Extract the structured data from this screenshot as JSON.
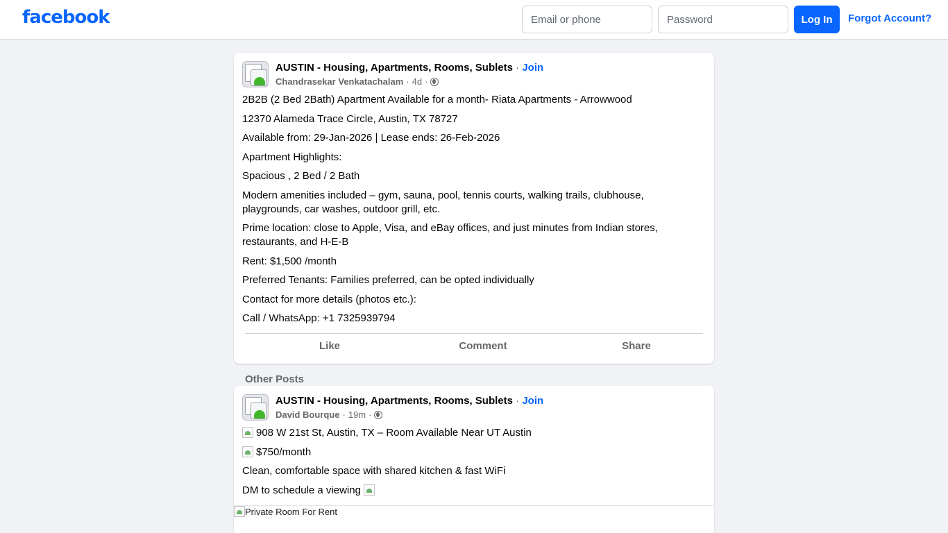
{
  "header": {
    "logo": "facebook",
    "email_placeholder": "Email or phone",
    "password_placeholder": "Password",
    "login_label": "Log In",
    "forgot_label": "Forgot Account?"
  },
  "post1": {
    "group": "AUSTIN - Housing, Apartments, Rooms, Sublets",
    "join": "Join",
    "author": "Chandrasekar Venkatachalam",
    "time": "4d",
    "lines": [
      "2B2B (2 Bed 2Bath) Apartment Available for a month- Riata Apartments - Arrowwood",
      "12370 Alameda Trace Circle, Austin, TX 78727",
      "Available from: 29-Jan-2026 | Lease ends: 26-Feb-2026",
      "Apartment Highlights:",
      "Spacious , 2 Bed / 2 Bath",
      "Modern amenities included – gym, sauna, pool, tennis courts, walking trails, clubhouse, playgrounds, car washes, outdoor grill, etc.",
      "Prime location: close to Apple, Visa, and eBay offices, and just minutes from Indian stores, restaurants, and H-E-B",
      "Rent: $1,500 /month",
      "Preferred Tenants: Families preferred, can be opted individually",
      "Contact for more details (photos etc.):",
      "Call / WhatsApp: +1 7325939794"
    ],
    "actions": {
      "like": "Like",
      "comment": "Comment",
      "share": "Share"
    }
  },
  "other_posts_label": "Other Posts",
  "post2": {
    "group": "AUSTIN - Housing, Apartments, Rooms, Sublets",
    "join": "Join",
    "author": "David Bourque",
    "time": "19m",
    "lines": [
      "908 W 21st St, Austin, TX – Room Available Near UT Austin",
      "$750/month",
      "Clean, comfortable space with shared kitchen & fast WiFi",
      "DM to schedule a viewing"
    ],
    "image_alt": "Private Room For Rent"
  },
  "colors": {
    "brand": "#0866ff",
    "background": "#f0f2f5",
    "secondary_text": "#65676b"
  }
}
